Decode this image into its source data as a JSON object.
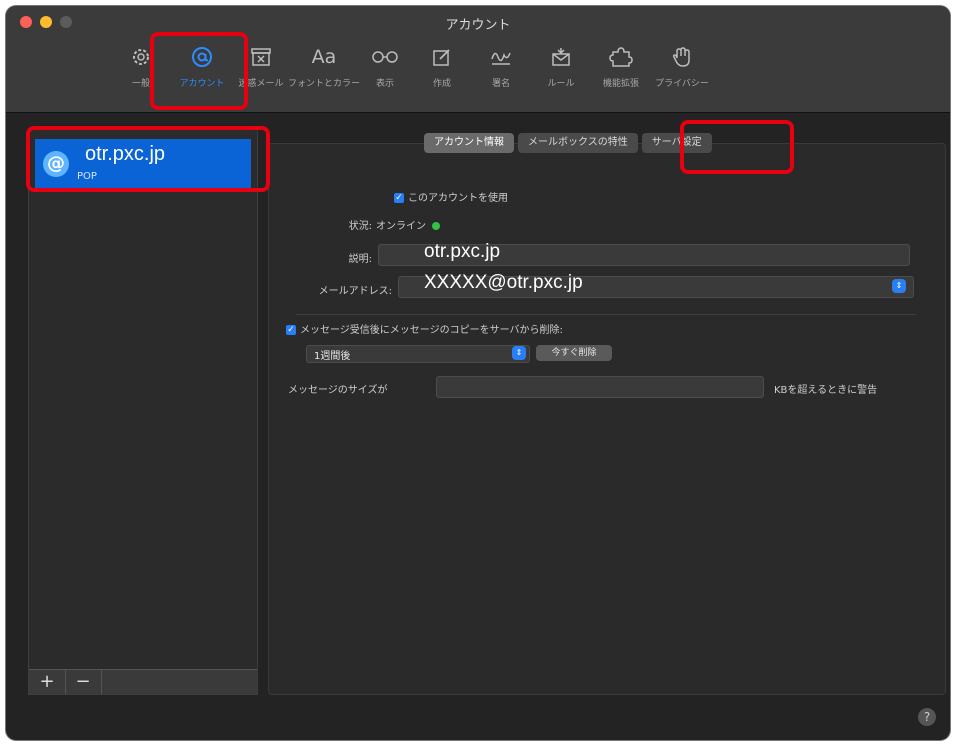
{
  "window": {
    "title": "アカウント"
  },
  "toolbar": {
    "items": [
      {
        "label": "一般",
        "icon": "gear-icon"
      },
      {
        "label": "アカウント",
        "icon": "at-icon"
      },
      {
        "label": "迷惑メール",
        "icon": "junk-icon"
      },
      {
        "label": "フォントとカラー",
        "icon": "fonts-icon",
        "glyph": "Aa"
      },
      {
        "label": "表示",
        "icon": "glasses-icon"
      },
      {
        "label": "作成",
        "icon": "compose-icon"
      },
      {
        "label": "署名",
        "icon": "signature-icon"
      },
      {
        "label": "ルール",
        "icon": "rules-icon"
      },
      {
        "label": "機能拡張",
        "icon": "puzzle-icon"
      },
      {
        "label": "プライバシー",
        "icon": "hand-icon"
      }
    ]
  },
  "sidebar": {
    "account": {
      "name": "otr.pxc.jp",
      "type": "POP",
      "icon_glyph": "@"
    },
    "add_label": "+",
    "remove_label": "−"
  },
  "tabs": [
    {
      "label": "アカウント情報"
    },
    {
      "label": "メールボックスの特性"
    },
    {
      "label": "サーバ設定"
    }
  ],
  "form": {
    "enable_label": "このアカウントを使用",
    "status_label": "状況:",
    "status_value": "オンライン",
    "description_label": "説明:",
    "description_value": "otr.pxc.jp",
    "email_label": "メールアドレス:",
    "email_value": "XXXXX@otr.pxc.jp",
    "remove_copy_label": "メッセージ受信後にメッセージのコピーをサーバから削除:",
    "remove_after_value": "1週間後",
    "remove_now_label": "今すぐ削除",
    "size_prefix": "メッセージのサイズが",
    "size_suffix": "KBを超えるときに警告"
  },
  "help_label": "?",
  "colors": {
    "accent": "#0a64d6",
    "highlight": "#e60012",
    "online": "#31c24a"
  }
}
